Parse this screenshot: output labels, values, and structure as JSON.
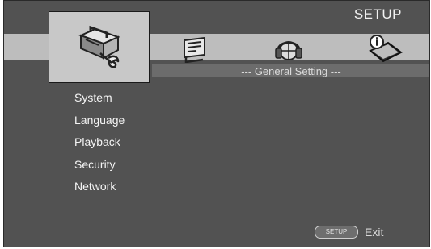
{
  "header": {
    "title": "SETUP"
  },
  "tabs": [
    {
      "id": "general",
      "icon": "toolbox-wrench-icon",
      "selected": true
    },
    {
      "id": "display",
      "icon": "display-screen-icon",
      "selected": false
    },
    {
      "id": "audio",
      "icon": "headphones-icon",
      "selected": false
    },
    {
      "id": "information",
      "icon": "info-book-icon",
      "selected": false
    }
  ],
  "section": {
    "title": "--- General Setting ---"
  },
  "menu": {
    "items": [
      {
        "label": "System"
      },
      {
        "label": "Language"
      },
      {
        "label": "Playback"
      },
      {
        "label": "Security"
      },
      {
        "label": "Network"
      }
    ]
  },
  "footer": {
    "button_label": "SETUP",
    "exit_label": "Exit"
  },
  "colors": {
    "background": "#525252",
    "tab_band": "#bdbdbd",
    "selected_tab": "#c8c8c8",
    "section_bar": "#6c6c6c",
    "text": "#f5f5f5"
  }
}
